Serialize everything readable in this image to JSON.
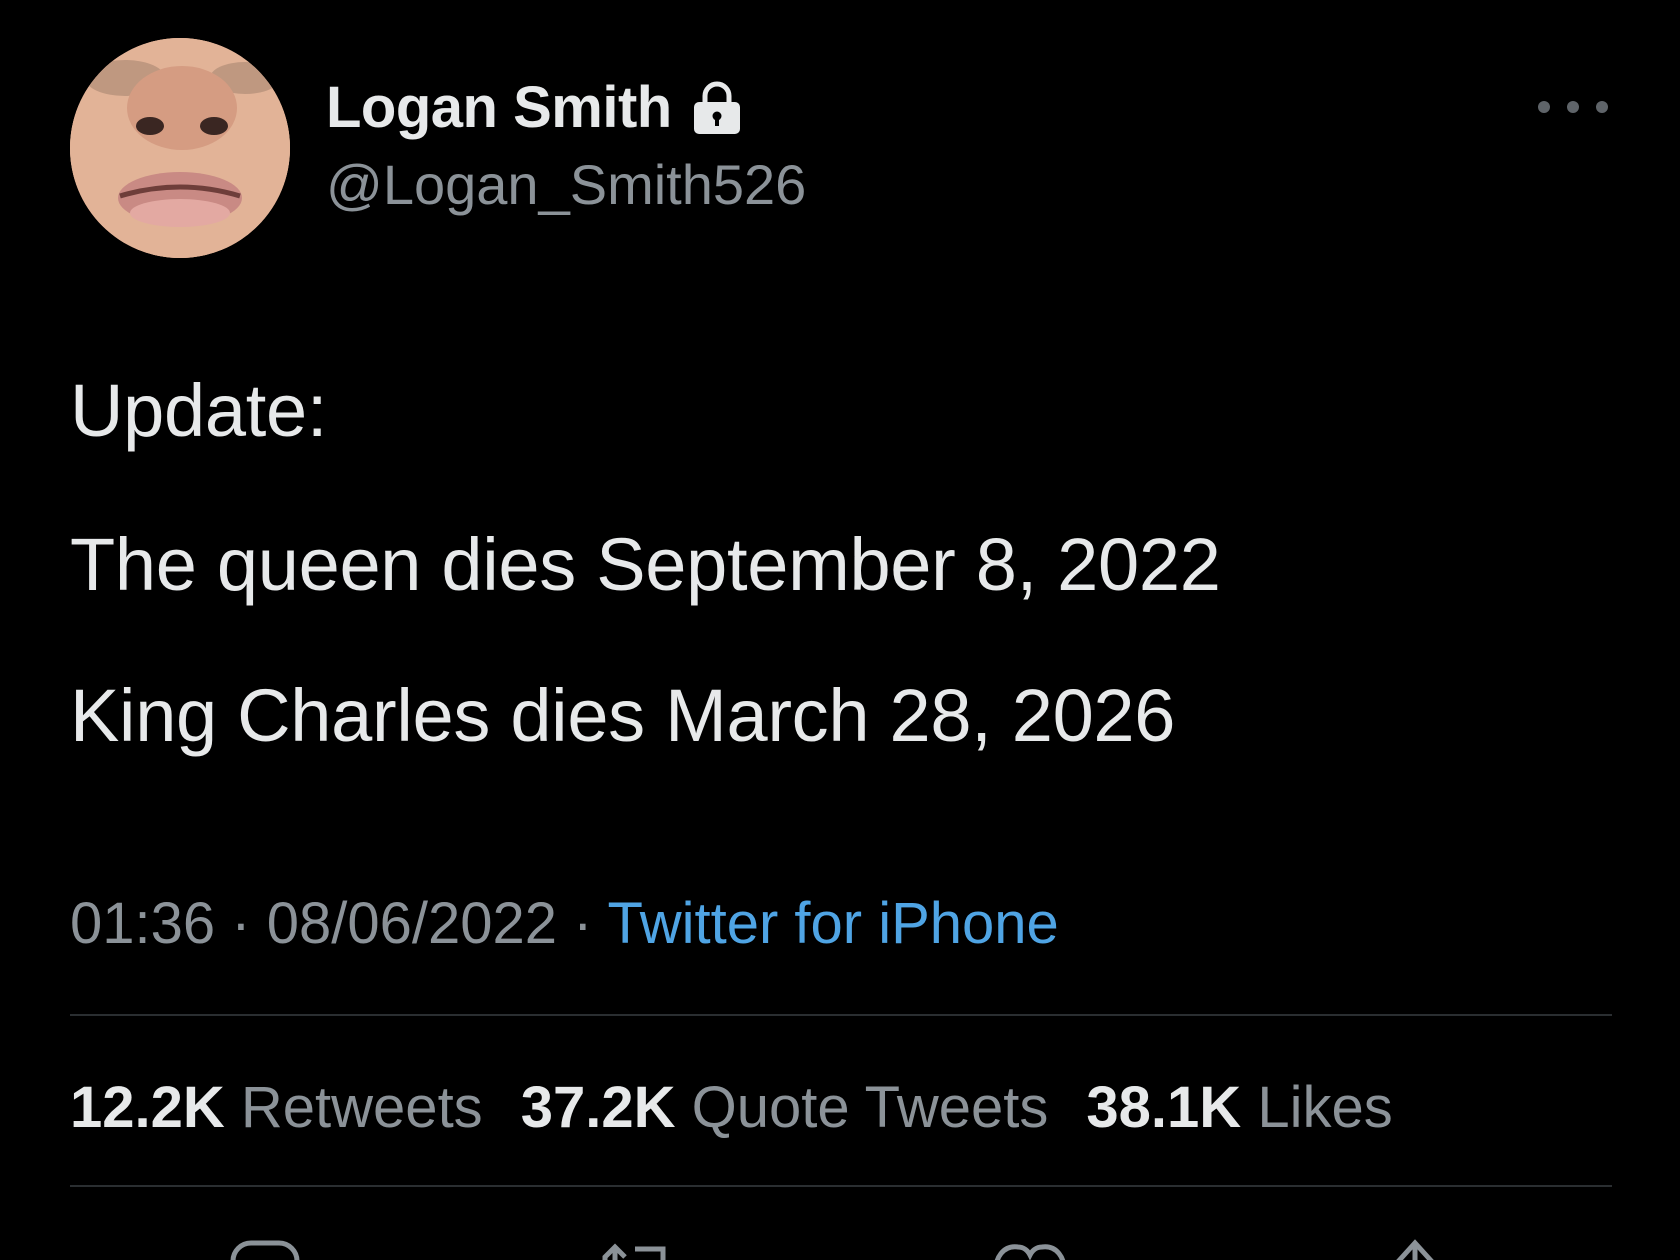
{
  "tweet": {
    "author": {
      "display_name": "Logan Smith",
      "handle": "@Logan_Smith526",
      "protected_icon": "lock-icon"
    },
    "more_icon": "more-horizontal-icon",
    "lines": [
      "Update:",
      "The queen dies September 8, 2022",
      "King Charles dies March 28, 2026"
    ],
    "meta": {
      "time": "01:36",
      "separator": " · ",
      "date": "08/06/2022",
      "source": "Twitter for iPhone"
    },
    "stats": {
      "retweets": {
        "value": "12.2K",
        "label": "Retweets"
      },
      "quote_tweets": {
        "value": "37.2K",
        "label": "Quote Tweets"
      },
      "likes": {
        "value": "38.1K",
        "label": "Likes"
      }
    },
    "actions": [
      "reply-icon",
      "retweet-icon",
      "like-icon",
      "share-icon"
    ]
  },
  "colors": {
    "background": "#000000",
    "text_primary": "#e7e9ea",
    "text_secondary": "#8b9298",
    "link": "#4fa4e4",
    "divider": "#2a2e31"
  }
}
